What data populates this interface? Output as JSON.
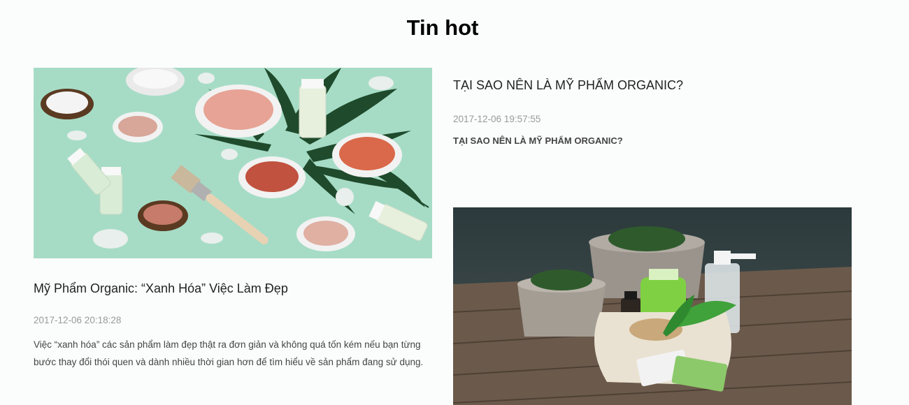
{
  "section": {
    "title": "Tin hot"
  },
  "featured": {
    "title": "Mỹ Phẩm Organic: “Xanh Hóa” Việc Làm Đẹp",
    "date": "2017-12-06 20:18:28",
    "excerpt": "Việc “xanh hóa” các sản phẩm làm đẹp thật ra đơn giản và không quá tốn kém nếu bạn từng bước thay đổi thói quen và dành nhiều thời gian hơn để tìm hiểu về sản phẩm đang sử dụng."
  },
  "second": {
    "title": "TẠI SAO NÊN LÀ MỸ PHẨM ORGANIC?",
    "date": "2017-12-06 19:57:55",
    "summary": "TẠI SAO NÊN LÀ MỸ PHẨM ORGANIC?"
  },
  "colors": {
    "mint_background": "#a6dcc6",
    "leaf_green": "#1f4a2c",
    "wood": "#6b5a4b",
    "date_gray": "#999999"
  }
}
